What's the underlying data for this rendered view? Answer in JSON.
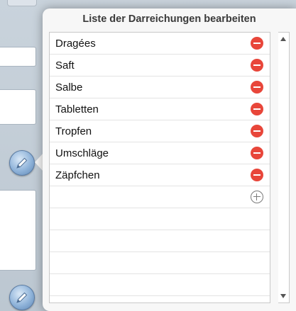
{
  "popover": {
    "title": "Liste der Darreichungen bearbeiten",
    "items": [
      {
        "label": "Dragées"
      },
      {
        "label": "Saft"
      },
      {
        "label": "Salbe"
      },
      {
        "label": "Tabletten"
      },
      {
        "label": "Tropfen"
      },
      {
        "label": "Umschläge"
      },
      {
        "label": "Zäpfchen"
      }
    ],
    "empty_rows": 4,
    "colors": {
      "delete": "#e8463a",
      "background": "#f7f7f7",
      "backdrop": "#c4ced8"
    },
    "icons": {
      "delete": "minus-circle-icon",
      "add": "plus-circle-icon",
      "edit": "pencil-icon",
      "scroll_up": "triangle-up-icon",
      "scroll_down": "triangle-down-icon"
    }
  }
}
